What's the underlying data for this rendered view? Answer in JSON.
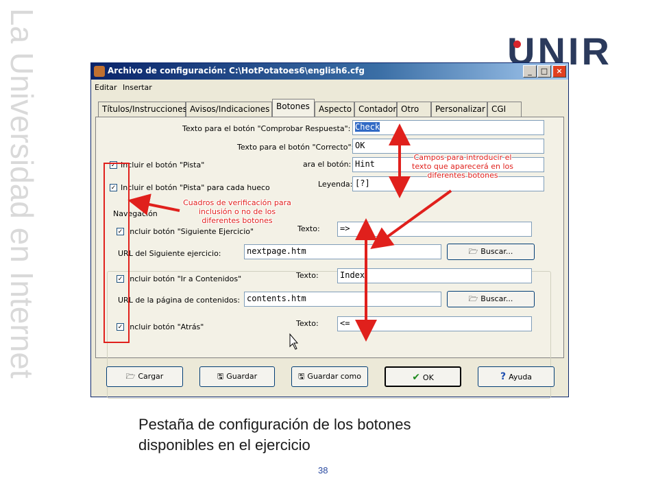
{
  "slide": {
    "side_text": "La Universidad en Internet",
    "logo": "UNIR",
    "caption_line1": "Pestaña de configuración de los botones",
    "caption_line2": "disponibles en el ejercicio",
    "page_number": "38"
  },
  "window": {
    "title": "Archivo de configuración: C:\\HotPotatoes6\\english6.cfg",
    "minimize": "_",
    "maximize": "□",
    "close": "×",
    "menu": [
      "Editar",
      "Insertar"
    ],
    "tabs": [
      "Títulos/Instrucciones",
      "Avisos/Indicaciones",
      "Botones",
      "Aspecto",
      "Contador",
      "Otro",
      "Personalizar",
      "CGI"
    ],
    "active_tab": "Botones"
  },
  "panel": {
    "check_label": "Texto para el botón \"Comprobar Respuesta\":",
    "check_value": "Check",
    "correct_label": "Texto para el botón \"Correcto\":",
    "correct_value": "OK",
    "hint_check": "Incluir el botón \"Pista\"",
    "hint_label": "ara el botón:",
    "hint_value": "Hint",
    "hint_each_check": "Incluir el botón \"Pista\" para cada hueco",
    "legend_label": "Leyenda:",
    "legend_value": "[?]",
    "nav_title": "Navegación",
    "next_check": "Incluir botón \"Siguiente Ejercicio\"",
    "next_text_label": "Texto:",
    "next_text_value": "=>",
    "next_url_label": "URL del Siguiente ejercicio:",
    "next_url_value": "nextpage.htm",
    "browse_label": "Buscar...",
    "contents_check": "Incluir botón \"Ir a Contenidos\"",
    "contents_text_label": "Texto:",
    "contents_text_value": "Index",
    "contents_url_label": "URL de la página de contenidos:",
    "contents_url_value": "contents.htm",
    "back_check": "Incluir botón \"Atrás\"",
    "back_text_label": "Texto:",
    "back_text_value": "<="
  },
  "buttons": {
    "load": "Cargar",
    "save": "Guardar",
    "save_as": "Guardar como",
    "ok": "OK",
    "help": "Ayuda"
  },
  "annotations": {
    "fields_note_1": "Campos para introducir el",
    "fields_note_2": "texto que aparecerá en los",
    "fields_note_3": "diferentes botones",
    "checks_note_1": "Cuadros de verificación para",
    "checks_note_2": "inclusión o no de los",
    "checks_note_3": "diferentes botones"
  },
  "colors": {
    "annotation_red": "#e0201c",
    "title_blue": "#0a246a",
    "logo_navy": "#2b3a5c"
  }
}
